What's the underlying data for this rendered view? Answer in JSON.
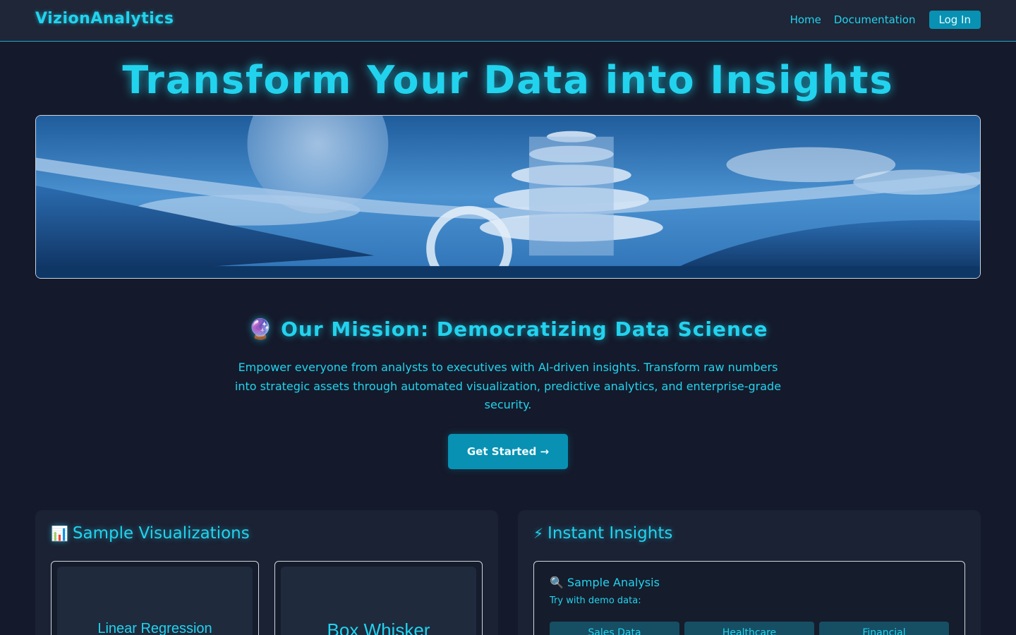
{
  "nav": {
    "brand": "VizionAnalytics",
    "links": [
      "Home",
      "Documentation"
    ],
    "login": "Log In"
  },
  "hero": {
    "title": "Transform Your Data into Insights"
  },
  "mission": {
    "icon": "🔮",
    "title": "Our Mission: Democratizing Data Science",
    "text": "Empower everyone from analysts to executives with AI-driven insights. Transform raw numbers into strategic assets through automated visualization, predictive analytics, and enterprise-grade security.",
    "cta": "Get Started →"
  },
  "visualizations": {
    "icon": "📊",
    "title": "Sample Visualizations",
    "cards": [
      "Linear Regression",
      "Box Whisker"
    ]
  },
  "insights": {
    "icon": "⚡",
    "title": "Instant Insights",
    "analysis_icon": "🔍",
    "analysis_title": "Sample Analysis",
    "analysis_sub": "Try with demo data:",
    "demo_buttons": [
      "Sales Data",
      "Healthcare",
      "Financial"
    ]
  },
  "colors": {
    "accent": "#22d3ee",
    "button": "#0891b2",
    "background": "#141a2b",
    "nav_background": "#1e2637"
  }
}
